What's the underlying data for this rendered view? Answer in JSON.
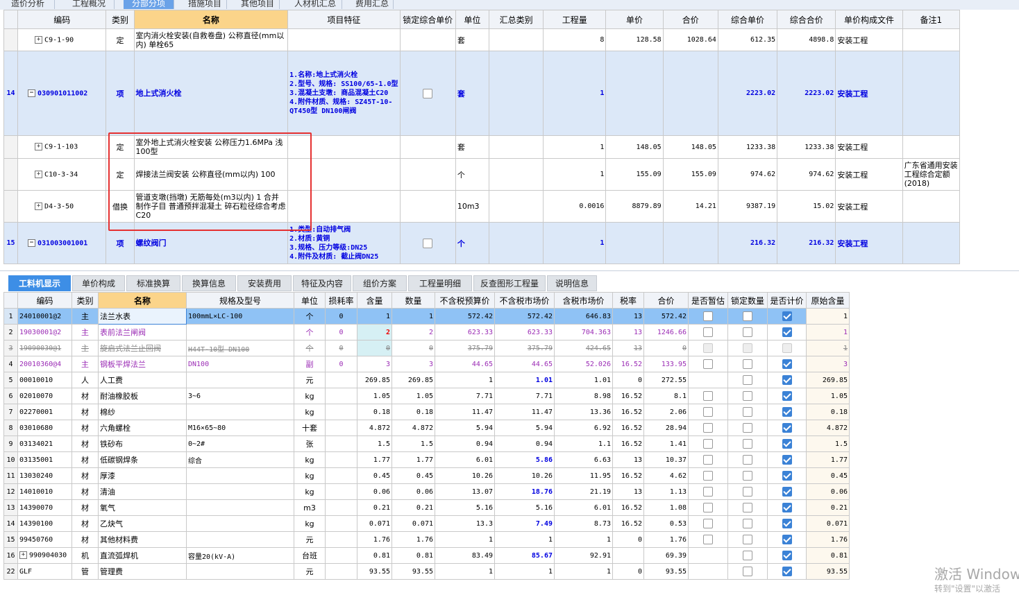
{
  "top_tabs": [
    "造价分析",
    "工程概况",
    "分部分项",
    "措施项目",
    "其他项目",
    "人材机汇总",
    "费用汇总"
  ],
  "top_tab_active": "分部分项",
  "upper": {
    "columns": [
      "",
      "编码",
      "类别",
      "名称",
      "项目特征",
      "锁定综合单价",
      "单位",
      "汇总类别",
      "工程量",
      "单价",
      "合价",
      "综合单价",
      "综合合价",
      "单价构成文件",
      "备注1"
    ],
    "rows": [
      {
        "rn": "",
        "code": "C9-1-90",
        "type": "定",
        "name": "室内消火栓安装(自救卷盘) 公称直径(mm以内) 单栓65",
        "feature": "",
        "lock": "",
        "unit": "套",
        "sum_cat": "",
        "qty": "8",
        "price": "128.58",
        "amount": "1028.64",
        "comp_price": "612.35",
        "comp_amount": "4898.8",
        "file": "安装工程",
        "note": ""
      },
      {
        "rn": "14",
        "code": "030901011002",
        "type": "项",
        "name": "地上式消火栓",
        "feature": "1.名称:地上式消火栓\n2.型号、规格: SS100/65-1.0型\n3.混凝土支墩: 商品混凝土C20\n4.附件材质、规格: SZ45T-10-QT450型 DN100闸阀",
        "lock": "checkbox",
        "unit": "套",
        "sum_cat": "",
        "qty": "1",
        "price": "",
        "amount": "",
        "comp_price": "2223.02",
        "comp_amount": "2223.02",
        "file": "安装工程",
        "note": ""
      },
      {
        "rn": "",
        "code": "C9-1-103",
        "type": "定",
        "name": "室外地上式消火栓安装 公称压力1.6MPa 浅100型",
        "feature": "",
        "lock": "",
        "unit": "套",
        "sum_cat": "",
        "qty": "1",
        "price": "148.05",
        "amount": "148.05",
        "comp_price": "1233.38",
        "comp_amount": "1233.38",
        "file": "安装工程",
        "note": ""
      },
      {
        "rn": "",
        "code": "C10-3-34",
        "type": "定",
        "name": "焊接法兰阀安装 公称直径(mm以内) 100",
        "feature": "",
        "lock": "",
        "unit": "个",
        "sum_cat": "",
        "qty": "1",
        "price": "155.09",
        "amount": "155.09",
        "comp_price": "974.62",
        "comp_amount": "974.62",
        "file": "安装工程",
        "note": "广东省通用安装工程综合定额(2018)"
      },
      {
        "rn": "",
        "code": "D4-3-50",
        "type": "借换",
        "name": "管道支墩(挡墩) 无筋每处(m3以内) 1 合并制作子目 普通预拌混凝土 碎石粒径综合考虑 C20",
        "feature": "",
        "lock": "",
        "unit": "10m3",
        "sum_cat": "",
        "qty": "0.0016",
        "price": "8879.89",
        "amount": "14.21",
        "comp_price": "9387.19",
        "comp_amount": "15.02",
        "file": "安装工程",
        "note": ""
      },
      {
        "rn": "15",
        "code": "031003001001",
        "type": "项",
        "name": "螺纹阀门",
        "feature": "1.类型:自动排气阀\n2.材质:黄铜\n3.规格、压力等级:DN25\n4.附件及材质: 截止阀DN25",
        "lock": "checkbox",
        "unit": "个",
        "sum_cat": "",
        "qty": "1",
        "price": "",
        "amount": "",
        "comp_price": "216.32",
        "comp_amount": "216.32",
        "file": "安装工程",
        "note": ""
      }
    ]
  },
  "bottom_tabs": [
    "工料机显示",
    "单价构成",
    "标准换算",
    "换算信息",
    "安装费用",
    "特征及内容",
    "组价方案",
    "工程量明细",
    "反查图形工程量",
    "说明信息"
  ],
  "bottom_tab_active": "工料机显示",
  "lower": {
    "columns": [
      "",
      "编码",
      "类别",
      "名称",
      "规格及型号",
      "单位",
      "损耗率",
      "含量",
      "数量",
      "不含税预算价",
      "不含税市场价",
      "含税市场价",
      "税率",
      "合价",
      "是否暂估",
      "锁定数量",
      "是否计价",
      "原始含量"
    ],
    "rows": [
      {
        "rn": "1",
        "code": "24010001@2",
        "type": "主",
        "name": "法兰水表",
        "spec": "100mmL×LC-100",
        "unit": "个",
        "loss": "0",
        "content": "1",
        "qty": "1",
        "pre_price": "572.42",
        "mkt_price": "572.42",
        "tax_mkt": "646.83",
        "tax": "13",
        "amount": "572.42",
        "est": "off",
        "lock": "off",
        "priced": "on",
        "orig": "1",
        "style": "sel"
      },
      {
        "rn": "2",
        "code": "19030001@2",
        "type": "主",
        "name": "表前法兰闸阀",
        "spec": "",
        "unit": "个",
        "loss": "0",
        "content": "2",
        "qty": "2",
        "pre_price": "623.33",
        "mkt_price": "623.33",
        "tax_mkt": "704.363",
        "tax": "13",
        "amount": "1246.66",
        "est": "off",
        "lock": "off",
        "priced": "on",
        "orig": "1",
        "style": "purple"
      },
      {
        "rn": "3",
        "code": "19090030@1",
        "type": "主",
        "name": "旋启式法兰止回阀",
        "spec": "H44T-10型 DN100",
        "unit": "个",
        "loss": "0",
        "content": "0",
        "qty": "0",
        "pre_price": "375.79",
        "mkt_price": "375.79",
        "tax_mkt": "424.65",
        "tax": "13",
        "amount": "0",
        "est": "dis",
        "lock": "dis",
        "priced": "dis",
        "orig": "1",
        "style": "strike"
      },
      {
        "rn": "4",
        "code": "20010360@4",
        "type": "主",
        "name": "钢板平焊法兰",
        "spec": "DN100",
        "unit": "副",
        "loss": "0",
        "content": "3",
        "qty": "3",
        "pre_price": "44.65",
        "mkt_price": "44.65",
        "tax_mkt": "52.026",
        "tax": "16.52",
        "amount": "133.95",
        "est": "off",
        "lock": "off",
        "priced": "on",
        "orig": "3",
        "style": "purple"
      },
      {
        "rn": "5",
        "code": "00010010",
        "type": "人",
        "name": "人工费",
        "spec": "",
        "unit": "元",
        "loss": "",
        "content": "269.85",
        "qty": "269.85",
        "pre_price": "1",
        "mkt_price": "1.01",
        "tax_mkt": "1.01",
        "tax": "0",
        "amount": "272.55",
        "est": "",
        "lock": "off",
        "priced": "on",
        "orig": "269.85",
        "style": "",
        "mkt_blue": true
      },
      {
        "rn": "6",
        "code": "02010070",
        "type": "材",
        "name": "耐油橡胶板",
        "spec": "3~6",
        "unit": "kg",
        "loss": "",
        "content": "1.05",
        "qty": "1.05",
        "pre_price": "7.71",
        "mkt_price": "7.71",
        "tax_mkt": "8.98",
        "tax": "16.52",
        "amount": "8.1",
        "est": "off",
        "lock": "off",
        "priced": "on",
        "orig": "1.05",
        "style": ""
      },
      {
        "rn": "7",
        "code": "02270001",
        "type": "材",
        "name": "棉纱",
        "spec": "",
        "unit": "kg",
        "loss": "",
        "content": "0.18",
        "qty": "0.18",
        "pre_price": "11.47",
        "mkt_price": "11.47",
        "tax_mkt": "13.36",
        "tax": "16.52",
        "amount": "2.06",
        "est": "off",
        "lock": "off",
        "priced": "on",
        "orig": "0.18",
        "style": ""
      },
      {
        "rn": "8",
        "code": "03010680",
        "type": "材",
        "name": "六角螺栓",
        "spec": "M16×65~80",
        "unit": "十套",
        "loss": "",
        "content": "4.872",
        "qty": "4.872",
        "pre_price": "5.94",
        "mkt_price": "5.94",
        "tax_mkt": "6.92",
        "tax": "16.52",
        "amount": "28.94",
        "est": "off",
        "lock": "off",
        "priced": "on",
        "orig": "4.872",
        "style": ""
      },
      {
        "rn": "9",
        "code": "03134021",
        "type": "材",
        "name": "铁砂布",
        "spec": "0~2#",
        "unit": "张",
        "loss": "",
        "content": "1.5",
        "qty": "1.5",
        "pre_price": "0.94",
        "mkt_price": "0.94",
        "tax_mkt": "1.1",
        "tax": "16.52",
        "amount": "1.41",
        "est": "off",
        "lock": "off",
        "priced": "on",
        "orig": "1.5",
        "style": ""
      },
      {
        "rn": "10",
        "code": "03135001",
        "type": "材",
        "name": "低碳钢焊条",
        "spec": "综合",
        "unit": "kg",
        "loss": "",
        "content": "1.77",
        "qty": "1.77",
        "pre_price": "6.01",
        "mkt_price": "5.86",
        "tax_mkt": "6.63",
        "tax": "13",
        "amount": "10.37",
        "est": "off",
        "lock": "off",
        "priced": "on",
        "orig": "1.77",
        "style": "",
        "mkt_blue": true
      },
      {
        "rn": "11",
        "code": "13030240",
        "type": "材",
        "name": "厚漆",
        "spec": "",
        "unit": "kg",
        "loss": "",
        "content": "0.45",
        "qty": "0.45",
        "pre_price": "10.26",
        "mkt_price": "10.26",
        "tax_mkt": "11.95",
        "tax": "16.52",
        "amount": "4.62",
        "est": "off",
        "lock": "off",
        "priced": "on",
        "orig": "0.45",
        "style": ""
      },
      {
        "rn": "12",
        "code": "14010010",
        "type": "材",
        "name": "清油",
        "spec": "",
        "unit": "kg",
        "loss": "",
        "content": "0.06",
        "qty": "0.06",
        "pre_price": "13.07",
        "mkt_price": "18.76",
        "tax_mkt": "21.19",
        "tax": "13",
        "amount": "1.13",
        "est": "off",
        "lock": "off",
        "priced": "on",
        "orig": "0.06",
        "style": "",
        "mkt_blue": true
      },
      {
        "rn": "13",
        "code": "14390070",
        "type": "材",
        "name": "氧气",
        "spec": "",
        "unit": "m3",
        "loss": "",
        "content": "0.21",
        "qty": "0.21",
        "pre_price": "5.16",
        "mkt_price": "5.16",
        "tax_mkt": "6.01",
        "tax": "16.52",
        "amount": "1.08",
        "est": "off",
        "lock": "off",
        "priced": "on",
        "orig": "0.21",
        "style": ""
      },
      {
        "rn": "14",
        "code": "14390100",
        "type": "材",
        "name": "乙炔气",
        "spec": "",
        "unit": "kg",
        "loss": "",
        "content": "0.071",
        "qty": "0.071",
        "pre_price": "13.3",
        "mkt_price": "7.49",
        "tax_mkt": "8.73",
        "tax": "16.52",
        "amount": "0.53",
        "est": "off",
        "lock": "off",
        "priced": "on",
        "orig": "0.071",
        "style": "",
        "mkt_blue": true
      },
      {
        "rn": "15",
        "code": "99450760",
        "type": "材",
        "name": "其他材料费",
        "spec": "",
        "unit": "元",
        "loss": "",
        "content": "1.76",
        "qty": "1.76",
        "pre_price": "1",
        "mkt_price": "1",
        "tax_mkt": "1",
        "tax": "0",
        "amount": "1.76",
        "est": "off",
        "lock": "off",
        "priced": "on",
        "orig": "1.76",
        "style": ""
      },
      {
        "rn": "16",
        "code": "990904030",
        "type": "机",
        "name": "直流弧焊机",
        "spec": "容量20(kV·A)",
        "unit": "台班",
        "loss": "",
        "content": "0.81",
        "qty": "0.81",
        "pre_price": "83.49",
        "mkt_price": "85.67",
        "tax_mkt": "92.91",
        "tax": "",
        "amount": "69.39",
        "est": "",
        "lock": "off",
        "priced": "on",
        "orig": "0.81",
        "style": "",
        "mkt_blue": true,
        "expand": true
      },
      {
        "rn": "22",
        "code": "GLF",
        "type": "管",
        "name": "管理费",
        "spec": "",
        "unit": "元",
        "loss": "",
        "content": "93.55",
        "qty": "93.55",
        "pre_price": "1",
        "mkt_price": "1",
        "tax_mkt": "1",
        "tax": "0",
        "amount": "93.55",
        "est": "",
        "lock": "off",
        "priced": "on",
        "orig": "93.55",
        "style": ""
      }
    ]
  },
  "watermark": {
    "line1": "激活 Window",
    "line2": "转到\"设置\"以激活"
  },
  "colors": {
    "selected_row": "#8fc2f5",
    "item_row": "#dce8f8",
    "highlight_box": "#e53030",
    "active_tab": "#3d8ee6",
    "purple_text": "#9b2cb5"
  }
}
